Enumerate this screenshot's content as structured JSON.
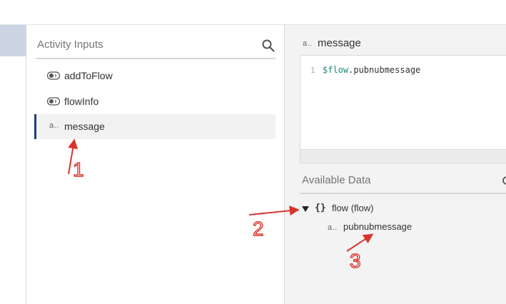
{
  "inputs_panel": {
    "title": "Activity Inputs",
    "items": [
      {
        "icon": "toggle-icon",
        "label": "addToFlow"
      },
      {
        "icon": "toggle-icon",
        "label": "flowInfo"
      },
      {
        "icon_text": "a..",
        "label": "message",
        "active": true
      }
    ]
  },
  "mapping": {
    "field_type_icon": "a..",
    "field_name": "message",
    "line_number": "1",
    "expr_var": "$flow",
    "expr_rest": ".pubnubmessage"
  },
  "available_data": {
    "title": "Available Data",
    "tree": {
      "object_icon": "{}",
      "label": "flow (flow)",
      "children": [
        {
          "icon_text": "a..",
          "label": "pubnubmessage"
        }
      ]
    }
  },
  "annotations": [
    "1",
    "2",
    "3"
  ],
  "colors": {
    "accent": "#1f3f7a",
    "annotation": "#d9342b",
    "code_var": "#1a8a7a"
  }
}
